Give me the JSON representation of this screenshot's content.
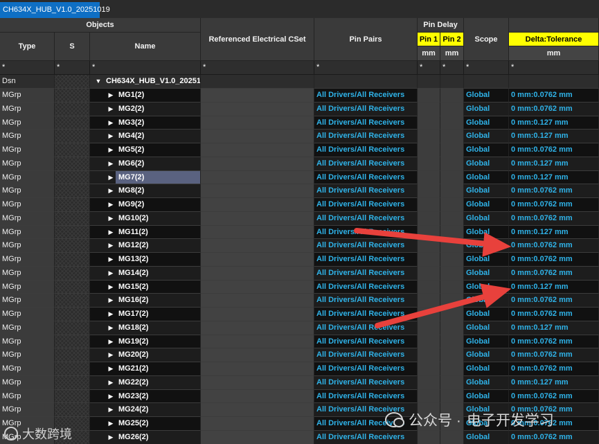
{
  "tab": {
    "title": "CH634X_HUB_V1.0_20251019"
  },
  "headers": {
    "objects": "Objects",
    "type": "Type",
    "s": "S",
    "name": "Name",
    "ref_cset": "Referenced Electrical CSet",
    "pin_pairs": "Pin Pairs",
    "pin_delay": "Pin Delay",
    "pin1": "Pin 1",
    "pin2": "Pin 2",
    "scope": "Scope",
    "delta_tol": "Delta:Tolerance",
    "unit_mm": "mm"
  },
  "filter": "*",
  "colors": {
    "tab": "#0e6fc4",
    "highlight_header": "#ffff00",
    "cyan_text": "#2fb3e9",
    "arrow": "#e8413c",
    "selection": "#5a6280"
  },
  "design_row": {
    "type": "Dsn",
    "name": "CH634X_HUB_V1.0_20251..."
  },
  "rows": [
    {
      "type": "MGrp",
      "name": "MG1(2)",
      "pin_pairs": "All Drivers/All Receivers",
      "scope": "Global",
      "delta": "0 mm:0.0762 mm"
    },
    {
      "type": "MGrp",
      "name": "MG2(2)",
      "pin_pairs": "All Drivers/All Receivers",
      "scope": "Global",
      "delta": "0 mm:0.0762 mm"
    },
    {
      "type": "MGrp",
      "name": "MG3(2)",
      "pin_pairs": "All Drivers/All Receivers",
      "scope": "Global",
      "delta": "0 mm:0.127 mm"
    },
    {
      "type": "MGrp",
      "name": "MG4(2)",
      "pin_pairs": "All Drivers/All Receivers",
      "scope": "Global",
      "delta": "0 mm:0.127 mm"
    },
    {
      "type": "MGrp",
      "name": "MG5(2)",
      "pin_pairs": "All Drivers/All Receivers",
      "scope": "Global",
      "delta": "0 mm:0.0762 mm"
    },
    {
      "type": "MGrp",
      "name": "MG6(2)",
      "pin_pairs": "All Drivers/All Receivers",
      "scope": "Global",
      "delta": "0 mm:0.127 mm"
    },
    {
      "type": "MGrp",
      "name": "MG7(2)",
      "pin_pairs": "All Drivers/All Receivers",
      "scope": "Global",
      "delta": "0 mm:0.127 mm",
      "selected": true
    },
    {
      "type": "MGrp",
      "name": "MG8(2)",
      "pin_pairs": "All Drivers/All Receivers",
      "scope": "Global",
      "delta": "0 mm:0.0762 mm"
    },
    {
      "type": "MGrp",
      "name": "MG9(2)",
      "pin_pairs": "All Drivers/All Receivers",
      "scope": "Global",
      "delta": "0 mm:0.0762 mm"
    },
    {
      "type": "MGrp",
      "name": "MG10(2)",
      "pin_pairs": "All Drivers/All Receivers",
      "scope": "Global",
      "delta": "0 mm:0.0762 mm"
    },
    {
      "type": "MGrp",
      "name": "MG11(2)",
      "pin_pairs": "All Drivers/All Receivers",
      "scope": "Global",
      "delta": "0 mm:0.127 mm"
    },
    {
      "type": "MGrp",
      "name": "MG12(2)",
      "pin_pairs": "All Drivers/All Receivers",
      "scope": "Global",
      "delta": "0 mm:0.0762 mm"
    },
    {
      "type": "MGrp",
      "name": "MG13(2)",
      "pin_pairs": "All Drivers/All Receivers",
      "scope": "Global",
      "delta": "0 mm:0.0762 mm"
    },
    {
      "type": "MGrp",
      "name": "MG14(2)",
      "pin_pairs": "All Drivers/All Receivers",
      "scope": "Global",
      "delta": "0 mm:0.0762 mm"
    },
    {
      "type": "MGrp",
      "name": "MG15(2)",
      "pin_pairs": "All Drivers/All Receivers",
      "scope": "Global",
      "delta": "0 mm:0.127 mm"
    },
    {
      "type": "MGrp",
      "name": "MG16(2)",
      "pin_pairs": "All Drivers/All Receivers",
      "scope": "Global",
      "delta": "0 mm:0.0762 mm"
    },
    {
      "type": "MGrp",
      "name": "MG17(2)",
      "pin_pairs": "All Drivers/All Receivers",
      "scope": "Global",
      "delta": "0 mm:0.0762 mm"
    },
    {
      "type": "MGrp",
      "name": "MG18(2)",
      "pin_pairs": "All Drivers/All Receivers",
      "scope": "Global",
      "delta": "0 mm:0.127 mm"
    },
    {
      "type": "MGrp",
      "name": "MG19(2)",
      "pin_pairs": "All Drivers/All Receivers",
      "scope": "Global",
      "delta": "0 mm:0.0762 mm"
    },
    {
      "type": "MGrp",
      "name": "MG20(2)",
      "pin_pairs": "All Drivers/All Receivers",
      "scope": "Global",
      "delta": "0 mm:0.0762 mm"
    },
    {
      "type": "MGrp",
      "name": "MG21(2)",
      "pin_pairs": "All Drivers/All Receivers",
      "scope": "Global",
      "delta": "0 mm:0.0762 mm"
    },
    {
      "type": "MGrp",
      "name": "MG22(2)",
      "pin_pairs": "All Drivers/All Receivers",
      "scope": "Global",
      "delta": "0 mm:0.127 mm"
    },
    {
      "type": "MGrp",
      "name": "MG23(2)",
      "pin_pairs": "All Drivers/All Receivers",
      "scope": "Global",
      "delta": "0 mm:0.0762 mm"
    },
    {
      "type": "MGrp",
      "name": "MG24(2)",
      "pin_pairs": "All Drivers/All Receivers",
      "scope": "Global",
      "delta": "0 mm:0.0762 mm"
    },
    {
      "type": "MGrp",
      "name": "MG25(2)",
      "pin_pairs": "All Drivers/All Receivers",
      "scope": "Global",
      "delta": "0 mm:0.0762 mm"
    },
    {
      "type": "MGrp",
      "name": "MG26(2)",
      "pin_pairs": "All Drivers/All Receivers",
      "scope": "Global",
      "delta": "0 mm:0.0762 mm"
    }
  ],
  "watermarks": {
    "left": "大数跨境",
    "right_prefix": "公众号 · ",
    "right": "电子开发学习"
  }
}
